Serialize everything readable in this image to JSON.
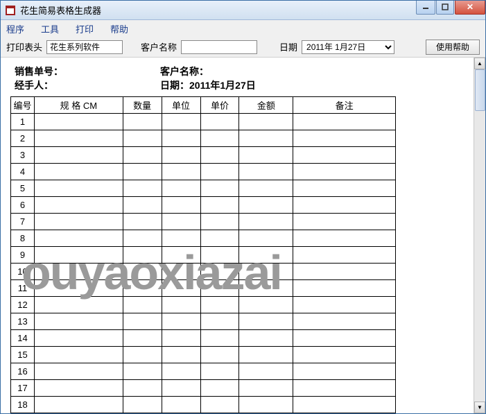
{
  "window": {
    "title": "花生简易表格生成器"
  },
  "menu": {
    "items": [
      "程序",
      "工具",
      "打印",
      "帮助"
    ]
  },
  "toolbar": {
    "header_label": "打印表头",
    "header_value": "花生系列软件",
    "customer_label": "客户名称",
    "customer_value": "",
    "date_label": "日期",
    "date_value": "2011年 1月27日",
    "help_button": "使用帮助"
  },
  "doc": {
    "sales_no_label": "销售单号：",
    "customer_label": "客户名称：",
    "handler_label": "经手人：",
    "date_label": "日期：",
    "date_value": "2011年1月27日",
    "cols": [
      "编号",
      "规   格 CM",
      "数量",
      "单位",
      "单价",
      "金额",
      "备注"
    ],
    "rows": [
      "1",
      "2",
      "3",
      "4",
      "5",
      "6",
      "7",
      "8",
      "9",
      "10",
      "11",
      "12",
      "13",
      "14",
      "15",
      "16",
      "17",
      "18"
    ]
  },
  "watermark": "ouyaoxiazai"
}
